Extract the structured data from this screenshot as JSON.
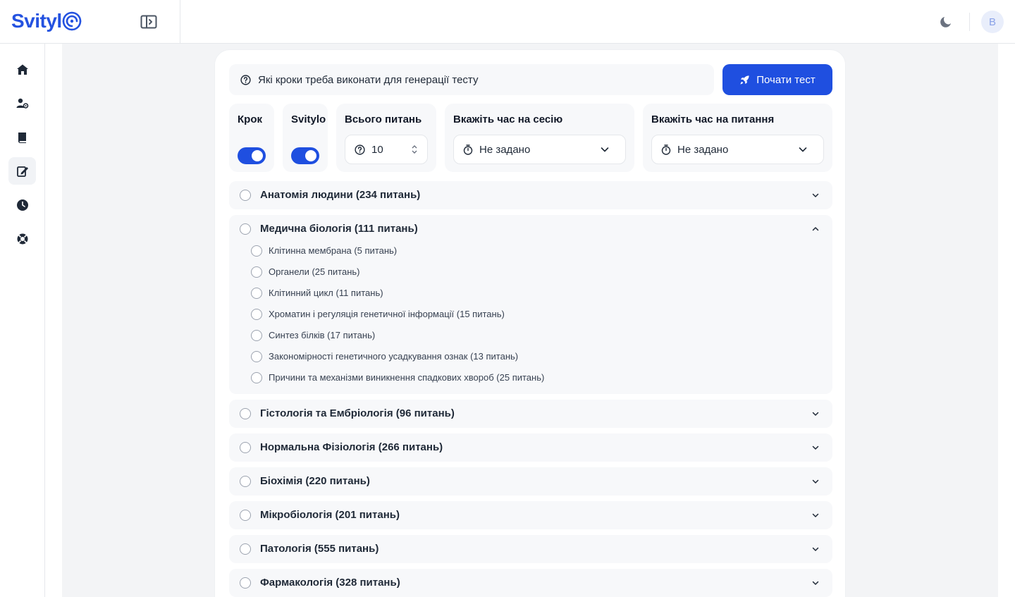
{
  "header": {
    "logo_text": "Svityl",
    "avatar_initial": "B"
  },
  "colors": {
    "accent": "#1f4fe0",
    "background": "#f3f4f6",
    "panel": "#f7f8fa"
  },
  "sidebar": {
    "items": [
      {
        "icon": "home-icon",
        "active": false
      },
      {
        "icon": "user-settings-icon",
        "active": false
      },
      {
        "icon": "book-icon",
        "active": false
      },
      {
        "icon": "edit-note-icon",
        "active": true
      },
      {
        "icon": "clock-icon",
        "active": false
      },
      {
        "icon": "lifebuoy-icon",
        "active": false
      }
    ]
  },
  "toolbar": {
    "hint": "Які кроки треба виконати для генерації тесту",
    "start_label": "Почати тест"
  },
  "options": {
    "krok": {
      "label": "Крок",
      "on": true
    },
    "svitylo": {
      "label": "Svitylo",
      "on": true
    },
    "total": {
      "label": "Всього питань",
      "value": "10"
    },
    "session_time": {
      "label": "Вкажіть час на сесію",
      "value": "Не задано"
    },
    "question_time": {
      "label": "Вкажіть час на питання",
      "value": "Не задано"
    }
  },
  "subjects": [
    {
      "title": "Анатомія людини (234 питань)",
      "expanded": false
    },
    {
      "title": "Медична біологія (111 питань)",
      "expanded": true,
      "topics": [
        "Клітинна мембрана (5 питань)",
        "Органели (25 питань)",
        "Клітинний цикл (11 питань)",
        "Хроматин і регуляція генетичної інформації (15 питань)",
        "Синтез білків (17 питань)",
        "Закономірності генетичного усадкування ознак (13 питань)",
        "Причини та механізми виникнення спадкових хвороб (25 питань)"
      ]
    },
    {
      "title": "Гістологія та Ембріологія (96 питань)",
      "expanded": false
    },
    {
      "title": "Нормальна Фізіологія (266 питань)",
      "expanded": false
    },
    {
      "title": "Біохімія (220 питань)",
      "expanded": false
    },
    {
      "title": "Мікробіологія (201 питань)",
      "expanded": false
    },
    {
      "title": "Патологія (555 питань)",
      "expanded": false
    },
    {
      "title": "Фармакологія (328 питань)",
      "expanded": false
    }
  ]
}
